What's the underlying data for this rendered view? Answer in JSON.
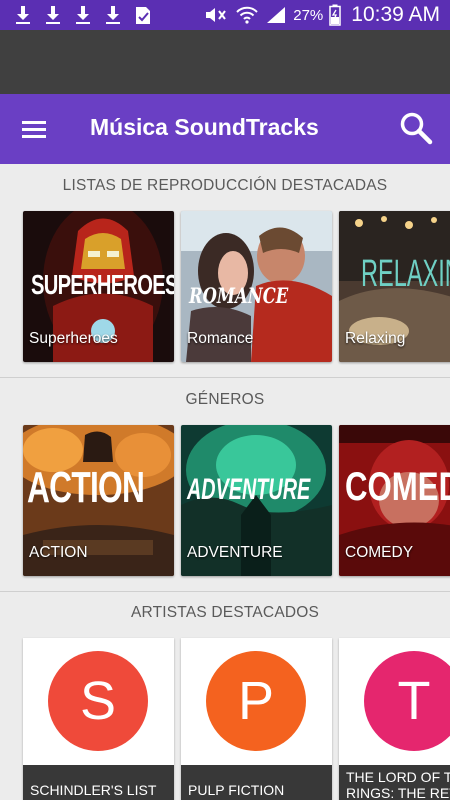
{
  "statusbar": {
    "battery": "27%",
    "time": "10:39 AM",
    "icons": [
      "download-icon",
      "download-icon",
      "download-icon",
      "download-icon",
      "check-doc-icon",
      "mute-icon",
      "wifi-icon",
      "signal-icon",
      "battery-icon"
    ]
  },
  "appbar": {
    "title": "Música SoundTracks",
    "menu_icon": "hamburger-menu-icon",
    "search_icon": "search-icon",
    "color": "#6a3fc4"
  },
  "sections": {
    "playlists": {
      "title": "LISTAS DE REPRODUCCIÓN DESTACADAS",
      "items": [
        {
          "art_text": "SUPERHEROES",
          "label": "Superheroes"
        },
        {
          "art_text": "ROMANCE",
          "label": "Romance"
        },
        {
          "art_text": "RELAXIN",
          "label": "Relaxing"
        }
      ]
    },
    "genres": {
      "title": "GÉNEROS",
      "items": [
        {
          "art_text": "ACTION",
          "label": "ACTION"
        },
        {
          "art_text": "ADVENTURE",
          "label": "ADVENTURE"
        },
        {
          "art_text": "COMED",
          "label": "COMEDY"
        }
      ]
    },
    "artists": {
      "title": "ARTISTAS DESTACADOS",
      "items": [
        {
          "initial": "S",
          "name": "SCHINDLER'S LIST",
          "color": "#ef4a3a"
        },
        {
          "initial": "P",
          "name": "PULP FICTION",
          "color": "#f4621f"
        },
        {
          "initial": "T",
          "name": "THE LORD OF THE RINGS: THE RET",
          "color": "#e5266e"
        }
      ]
    }
  }
}
